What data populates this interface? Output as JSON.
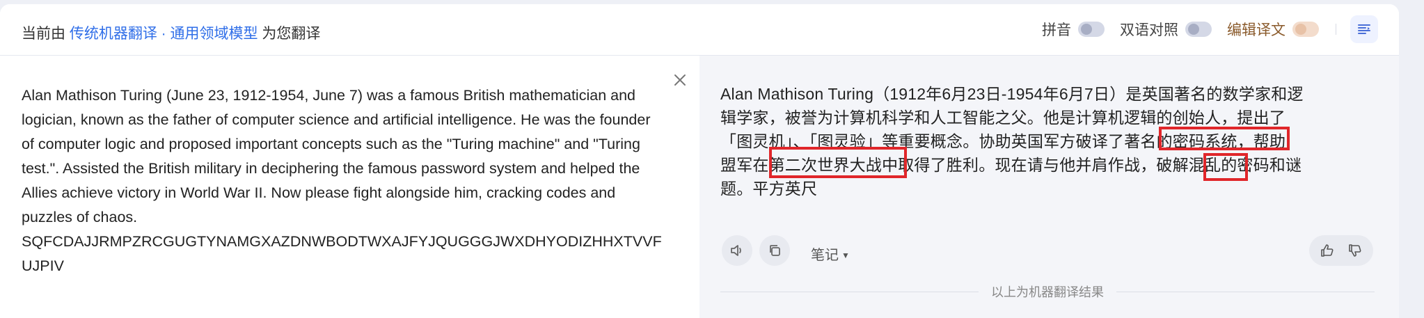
{
  "header": {
    "prefix": "当前由",
    "engine_link": "传统机器翻译 · 通用领域模型",
    "suffix": "为您翻译",
    "toggles": [
      {
        "label": "拼音",
        "on": false
      },
      {
        "label": "双语对照",
        "on": false
      },
      {
        "label": "编辑译文",
        "on": false
      }
    ],
    "layout_icon": "layout-panel-icon"
  },
  "source": {
    "text": "Alan Mathison Turing (June 23, 1912-1954, June 7) was a famous British mathematician and logician, known as the father of computer science and artificial intelligence. He was the founder of computer logic and proposed important concepts such as the \"Turing machine\" and \"Turing test.\". Assisted the British military in deciphering the famous password system and helped the Allies achieve victory in World War II. Now please fight alongside him, cracking codes and puzzles of chaos. SQFCDAJJRMPZRCGUGTYNAMGXAZDNWBODTWXAJFYJQUGGGJWXDHYODIZHHXTVVFUJPIV",
    "clear_icon": "close-icon"
  },
  "translation": {
    "lines": [
      "Alan Mathison Turing（1912年6月23日-1954年6月7日）是英国著名的数学家和逻",
      "辑学家，被誉为计算机科学和人工智能之父。他是计算机逻辑的创始人，提出了",
      "「图灵机」、「图灵验」等重要概念。协助英国军方破译了著名的密码系统，帮助",
      "盟军在第二次世界大战中取得了胜利。现在请与他并肩作战，破解混乱的密码和谜",
      "题。平方英尺"
    ],
    "annotation_color": "#e0262a"
  },
  "actions": {
    "speaker_icon": "speaker-icon",
    "copy_icon": "copy-icon",
    "notes_label": "笔记",
    "like_icon": "thumbs-up-icon",
    "dislike_icon": "thumbs-down-icon"
  },
  "footer": {
    "text": "以上为机器翻译结果"
  },
  "colors": {
    "accent": "#2f6ee8",
    "edit_label": "#8a5a2b",
    "pane_bg": "#f4f5f9"
  }
}
